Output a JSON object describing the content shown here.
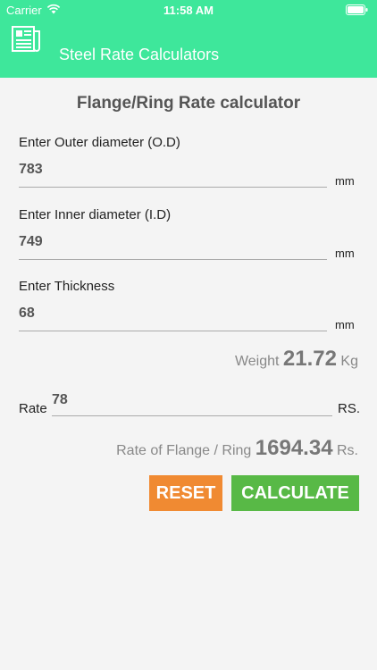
{
  "status": {
    "carrier": "Carrier",
    "time": "11:58 AM"
  },
  "header": {
    "title": "Steel Rate Calculators",
    "app_icon": "newspaper-icon"
  },
  "page": {
    "title": "Flange/Ring Rate calculator"
  },
  "fields": [
    {
      "label": "Enter Outer diameter (O.D)",
      "value": "783",
      "unit": "mm"
    },
    {
      "label": "Enter Inner diameter (I.D)",
      "value": "749",
      "unit": "mm"
    },
    {
      "label": "Enter Thickness",
      "value": "68",
      "unit": "mm"
    }
  ],
  "weight": {
    "label": "Weight",
    "value": "21.72",
    "unit": "Kg"
  },
  "rate": {
    "label": "Rate",
    "value": "78",
    "unit": "RS."
  },
  "result": {
    "label": "Rate of Flange / Ring",
    "value": "1694.34",
    "unit": "Rs."
  },
  "buttons": {
    "reset": "RESET",
    "calculate": "CALCULATE"
  },
  "colors": {
    "header": "#3ee79b",
    "reset": "#f08a32",
    "calculate": "#58b946"
  }
}
